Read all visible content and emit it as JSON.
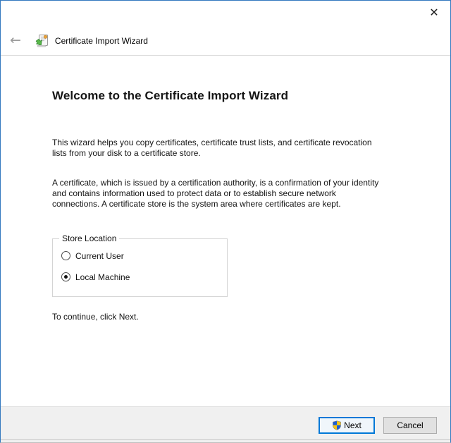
{
  "window": {
    "close_glyph": "✕"
  },
  "header": {
    "back_glyph": "←",
    "title": "Certificate Import Wizard"
  },
  "main": {
    "heading": "Welcome to the Certificate Import Wizard",
    "paragraphs": [
      "This wizard helps you copy certificates, certificate trust lists, and certificate revocation\nlists from your disk to a certificate store.",
      "A certificate, which is issued by a certification authority, is a confirmation of your identity\nand contains information used to protect data or to establish secure network\nconnections. A certificate store is the system area where certificates are kept."
    ],
    "store_location": {
      "legend": "Store Location",
      "options": [
        {
          "label": "Current User",
          "selected": false
        },
        {
          "label": "Local Machine",
          "selected": true
        }
      ]
    },
    "hint": "To continue, click Next."
  },
  "footer": {
    "next_label": "Next",
    "cancel_label": "Cancel"
  },
  "icons": {
    "app_icon": "certificate-import-wizard",
    "next_button_icon": "uac-shield"
  },
  "colors": {
    "accent_window_border": "#3379bf",
    "focused_button_border": "#0078d7",
    "focused_button_bg": "#f0f6fb",
    "footer_bg": "#f0f0f0",
    "button_bg": "#e1e1e1",
    "button_border": "#adadad",
    "shield_blue": "#1d5fd3",
    "shield_yellow": "#f8c513",
    "separator": "#dcdcdc"
  }
}
